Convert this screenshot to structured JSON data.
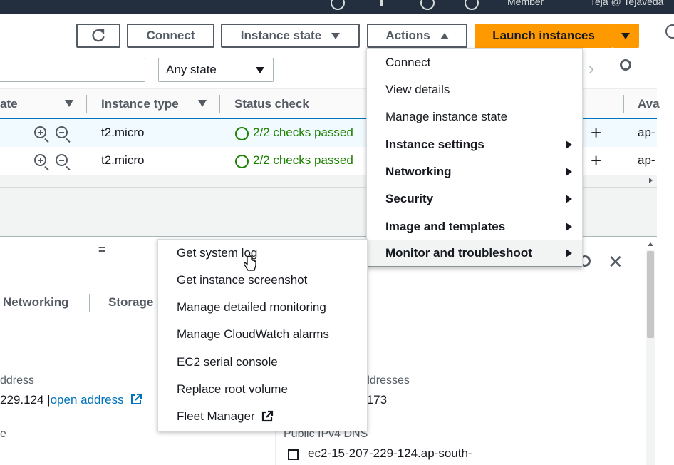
{
  "topbar": {
    "user_text": "Member",
    "account_text": "Teja @ Tejaveda"
  },
  "toolbar": {
    "connect_label": "Connect",
    "instance_state_label": "Instance state",
    "actions_label": "Actions",
    "launch_label": "Launch instances"
  },
  "filter": {
    "state_value": "Any state"
  },
  "table": {
    "headers": [
      "ate",
      "Instance type",
      "Status check",
      "Ava"
    ],
    "rows": [
      {
        "type": "t2.micro",
        "status": "2/2 checks passed",
        "az": "ap-"
      },
      {
        "type": "t2.micro",
        "status": "2/2 checks passed",
        "az": "ap-"
      }
    ]
  },
  "details": {
    "tabs": [
      "Networking",
      "Storage"
    ],
    "left_label": "ddress",
    "left_value": "229.124 |",
    "left_link": "open address",
    "left_label2": "e",
    "right_label": "ddresses",
    "right_value": ".173",
    "dns_label": "Public IPv4 DNS",
    "dns_value": "ec2-15-207-229-124.ap-south-"
  },
  "actions_menu": {
    "items": [
      {
        "label": "Connect",
        "bold": false,
        "submenu": false
      },
      {
        "label": "View details",
        "bold": false,
        "submenu": false
      },
      {
        "label": "Manage instance state",
        "bold": false,
        "submenu": false
      },
      {
        "label": "Instance settings",
        "bold": true,
        "submenu": true
      },
      {
        "label": "Networking",
        "bold": true,
        "submenu": true
      },
      {
        "label": "Security",
        "bold": true,
        "submenu": true
      },
      {
        "label": "Image and templates",
        "bold": true,
        "submenu": true
      },
      {
        "label": "Monitor and troubleshoot",
        "bold": true,
        "submenu": true
      }
    ]
  },
  "monitor_submenu": {
    "items": [
      {
        "label": "Get system log"
      },
      {
        "label": "Get instance screenshot"
      },
      {
        "label": "Manage detailed monitoring"
      },
      {
        "label": "Manage CloudWatch alarms"
      },
      {
        "label": "EC2 serial console"
      },
      {
        "label": "Replace root volume"
      },
      {
        "label": "Fleet Manager"
      }
    ]
  },
  "colors": {
    "accent": "#ff9900",
    "nav": "#232f3e",
    "link": "#0073bb",
    "success": "#1d8102"
  }
}
